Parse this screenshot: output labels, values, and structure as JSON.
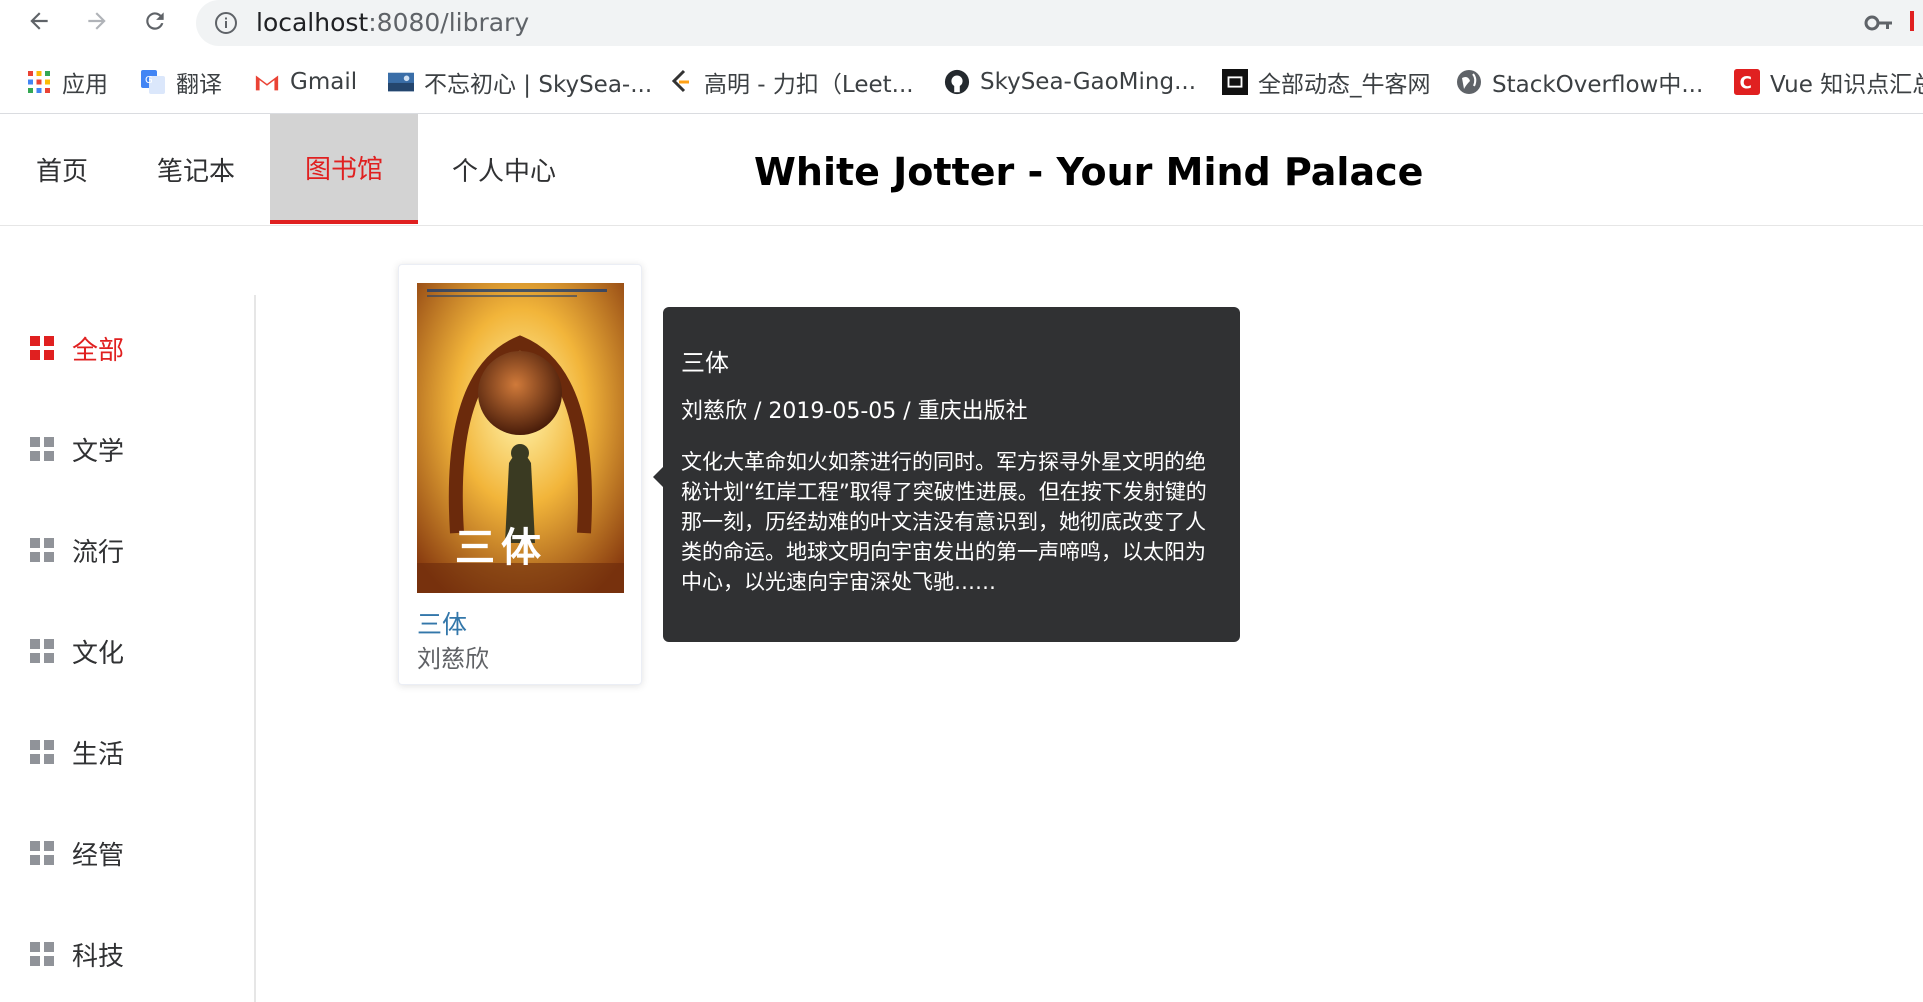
{
  "browser": {
    "url_host": "localhost",
    "url_rest": ":8080/library",
    "bookmarks": [
      {
        "label": "应用",
        "icon": "apps-grid-icon"
      },
      {
        "label": "翻译",
        "icon": "google-translate-icon"
      },
      {
        "label": "Gmail",
        "icon": "gmail-icon"
      },
      {
        "label": "不忘初心 | SkySea-...",
        "icon": "landscape-thumbnail-icon"
      },
      {
        "label": "高明 - 力扣（Leet...",
        "icon": "leetcode-icon"
      },
      {
        "label": "SkySea-GaoMing...",
        "icon": "github-icon"
      },
      {
        "label": "全部动态_牛客网",
        "icon": "nowcoder-icon"
      },
      {
        "label": "StackOverflow中...",
        "icon": "globe-icon"
      },
      {
        "label": "Vue 知识点汇总",
        "icon": "csdn-icon"
      }
    ]
  },
  "header": {
    "menu": [
      {
        "label": "首页"
      },
      {
        "label": "笔记本"
      },
      {
        "label": "图书馆",
        "active": true
      },
      {
        "label": "个人中心"
      }
    ],
    "title": "White Jotter - Your Mind Palace"
  },
  "sidebar": {
    "categories": [
      {
        "label": "全部",
        "active": true
      },
      {
        "label": "文学"
      },
      {
        "label": "流行"
      },
      {
        "label": "文化"
      },
      {
        "label": "生活"
      },
      {
        "label": "经管"
      },
      {
        "label": "科技"
      }
    ]
  },
  "book": {
    "title": "三体",
    "author": "刘慈欣",
    "cover_text": "三体"
  },
  "tooltip": {
    "title": "三体",
    "meta": "刘慈欣 / 2019-05-05 / 重庆出版社",
    "description": "文化大革命如火如荼进行的同时。军方探寻外星文明的绝秘计划“红岸工程”取得了突破性进展。但在按下发射键的那一刻，历经劫难的叶文洁没有意识到，她彻底改变了人类的命运。地球文明向宇宙发出的第一声啼鸣，以太阳为中心，以光速向宇宙深处飞驰……"
  },
  "colors": {
    "accent": "#e02020",
    "tooltip_bg": "#303133",
    "link": "#3377aa"
  }
}
